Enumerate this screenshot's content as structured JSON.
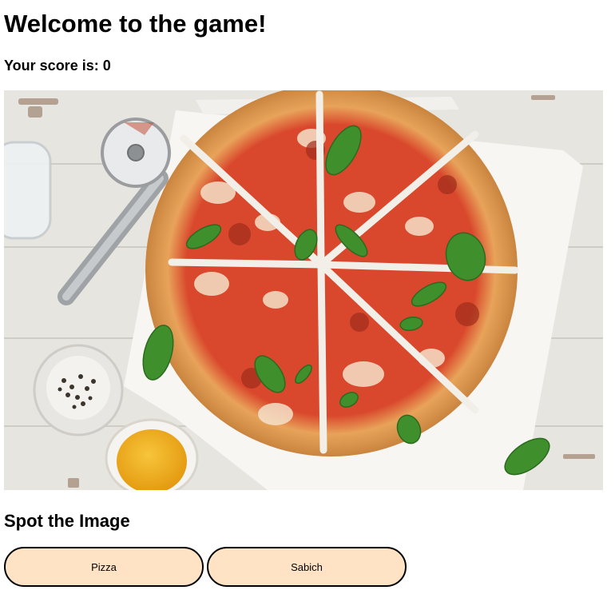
{
  "header": {
    "title": "Welcome to the game!",
    "score_text": "Your score is: 0"
  },
  "image": {
    "subject": "pizza-photo",
    "alt": "Pizza"
  },
  "question": {
    "title": "Spot the Image"
  },
  "answers": [
    {
      "label": "Pizza"
    },
    {
      "label": "Sabich"
    }
  ],
  "colors": {
    "button_fill": "#ffe3c4",
    "button_border": "#000000",
    "text": "#000000",
    "background": "#ffffff"
  }
}
